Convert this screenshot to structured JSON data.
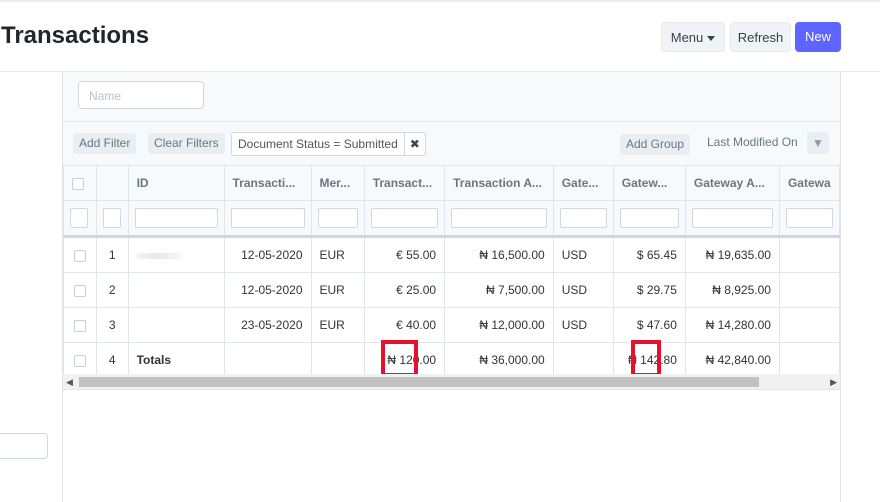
{
  "header": {
    "title": "Transactions",
    "menu_label": "Menu",
    "refresh_label": "Refresh",
    "new_label": "New"
  },
  "filters": {
    "name_placeholder": "Name",
    "add_filter": "Add Filter",
    "clear_filters": "Clear Filters",
    "status_filter": "Document Status = Submitted",
    "add_group": "Add Group",
    "sort_label": "Last Modified On"
  },
  "columns": [
    "ID",
    "Transacti...",
    "Mer...",
    "Transact...",
    "Transaction A...",
    "Gate...",
    "Gatew...",
    "Gateway A...",
    "Gatewa"
  ],
  "rows": [
    {
      "num": "1",
      "date": "12-05-2020",
      "cur": "EUR",
      "amt": "€ 55.00",
      "tamt": "₦ 16,500.00",
      "gcur": "USD",
      "gamt": "$ 65.45",
      "gwamt": "₦ 19,635.00"
    },
    {
      "num": "2",
      "date": "12-05-2020",
      "cur": "EUR",
      "amt": "€ 25.00",
      "tamt": "₦ 7,500.00",
      "gcur": "USD",
      "gamt": "$ 29.75",
      "gwamt": "₦ 8,925.00"
    },
    {
      "num": "3",
      "date": "23-05-2020",
      "cur": "EUR",
      "amt": "€ 40.00",
      "tamt": "₦ 12,000.00",
      "gcur": "USD",
      "gamt": "$ 47.60",
      "gwamt": "₦ 14,280.00"
    }
  ],
  "totals": {
    "num": "4",
    "label": "Totals",
    "amt": "₦ 120.00",
    "tamt": "₦ 36,000.00",
    "gamt": "₦ 142.80",
    "gwamt": "₦ 42,840.00"
  }
}
